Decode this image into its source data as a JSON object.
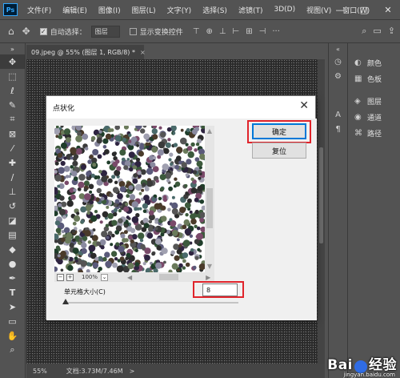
{
  "app": {
    "logo": "Ps"
  },
  "menu": [
    "文件(F)",
    "编辑(E)",
    "图像(I)",
    "图层(L)",
    "文字(Y)",
    "选择(S)",
    "滤镜(T)",
    "3D(D)",
    "视图(V)",
    "窗口(W)"
  ],
  "window_controls": {
    "minimize": "—",
    "maximize": "□",
    "close": "✕"
  },
  "options": {
    "auto_select_label": "自动选择：",
    "auto_select_checked": true,
    "auto_select_value": "图层",
    "show_transform_label": "显示变换控件",
    "show_transform_checked": false
  },
  "document": {
    "tab_title": "09.jpeg @ 55% (图层 1, RGB/8) *",
    "tab_close": "×",
    "status_zoom": "55%",
    "status_doc": "文档:3.73M/7.46M",
    "status_arrow": ">"
  },
  "panels": [
    {
      "icon": "palette-icon",
      "glyph": "◐",
      "label": "颜色"
    },
    {
      "icon": "swatches-icon",
      "glyph": "▦",
      "label": "色板"
    },
    {
      "icon": "layers-icon",
      "glyph": "◈",
      "label": "图层"
    },
    {
      "icon": "channels-icon",
      "glyph": "◉",
      "label": "通道"
    },
    {
      "icon": "paths-icon",
      "glyph": "⌘",
      "label": "路径"
    }
  ],
  "dialog": {
    "title": "点状化",
    "close": "✕",
    "ok_label": "确定",
    "reset_label": "复位",
    "zoom_out": "−",
    "zoom_in": "+",
    "zoom_value": "100%",
    "zoom_arrow": "⌄",
    "cell_size_label": "单元格大小(C)",
    "cell_size_value": "8",
    "slider_fraction": 0.0
  },
  "watermark": {
    "main_left": "Bai",
    "main_right": "经验",
    "sub": "jingyan.baidu.com"
  }
}
